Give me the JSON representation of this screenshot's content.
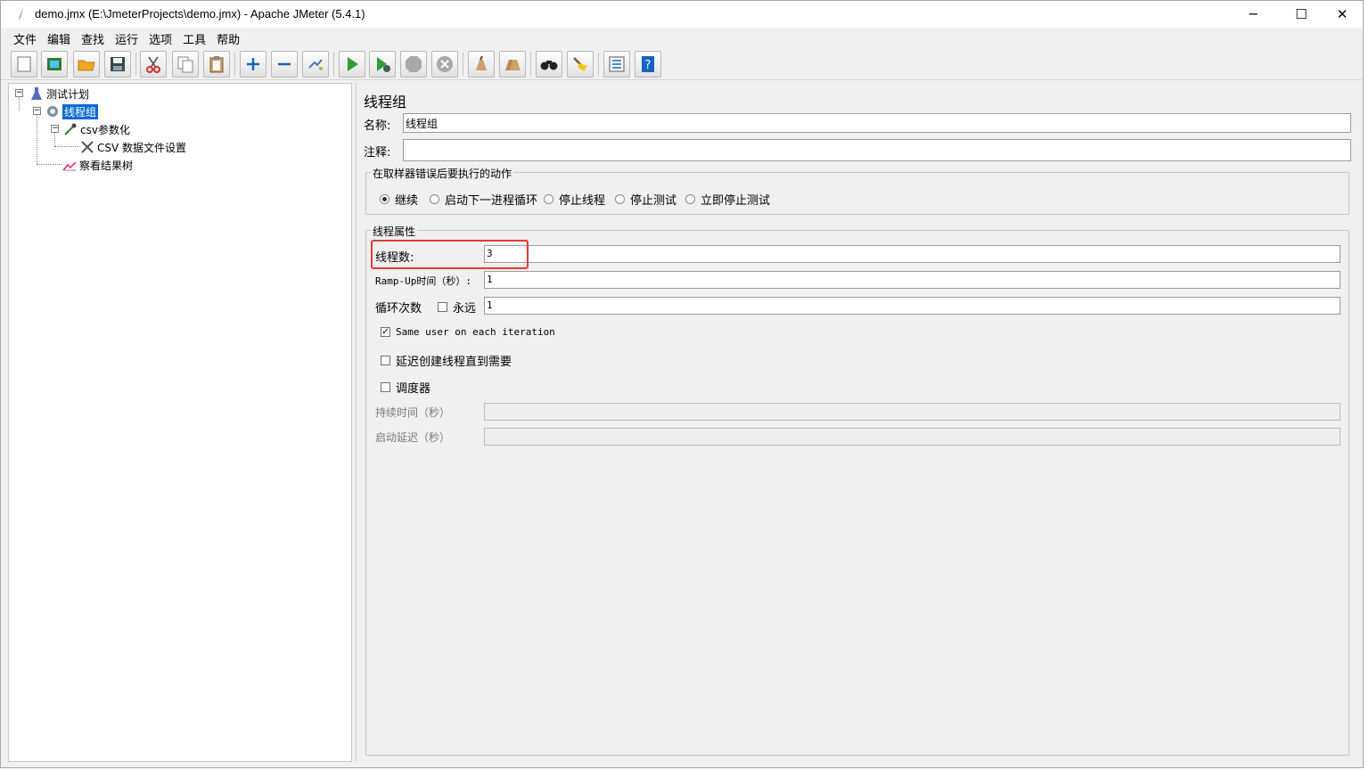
{
  "window": {
    "title": "demo.jmx (E:\\JmeterProjects\\demo.jmx) - Apache JMeter (5.4.1)",
    "minimize": "─",
    "maximize": "☐",
    "close": "✕"
  },
  "menu": [
    "文件",
    "编辑",
    "查找",
    "运行",
    "选项",
    "工具",
    "帮助"
  ],
  "toolbar": {
    "buttons": [
      "new-icon",
      "templates-icon",
      "open-icon",
      "save-icon",
      "cut-icon",
      "copy-icon",
      "paste-icon",
      "expand-icon",
      "collapse-icon",
      "toggle-icon",
      "start-icon",
      "start-no-pause-icon",
      "stop-icon",
      "shutdown-icon",
      "clear-icon",
      "clear-all-icon",
      "search-icon",
      "reset-search-icon",
      "function-helper-icon",
      "help-icon"
    ]
  },
  "tree": {
    "test_plan": "测试计划",
    "thread_group": "线程组",
    "csv_param": "csv参数化",
    "csv_config": "CSV 数据文件设置",
    "results_tree": "察看结果树"
  },
  "editor": {
    "heading": "线程组",
    "name_label": "名称:",
    "name_value": "线程组",
    "comment_label": "注释:",
    "comment_value": "",
    "error_action": {
      "legend": "在取样器错误后要执行的动作",
      "options": [
        "继续",
        "启动下一进程循环",
        "停止线程",
        "停止测试",
        "立即停止测试"
      ],
      "selected": "继续"
    },
    "thread_props": {
      "legend": "线程属性",
      "threads_label": "线程数:",
      "threads_value": "3",
      "rampup_label": "Ramp-Up时间（秒）:",
      "rampup_value": "1",
      "loop_label": "循环次数",
      "forever_label": "永远",
      "forever_checked": false,
      "loop_value": "1",
      "same_user_label": "Same user on each iteration",
      "same_user_checked": true,
      "delay_label": "延迟创建线程直到需要",
      "delay_checked": false,
      "scheduler_label": "调度器",
      "scheduler_checked": false,
      "duration_label": "持续时间（秒）",
      "duration_value": "",
      "startup_delay_label": "启动延迟（秒）",
      "startup_delay_value": ""
    }
  },
  "colors": {
    "highlight": "#e53935",
    "selection": "#0a6ad4"
  }
}
